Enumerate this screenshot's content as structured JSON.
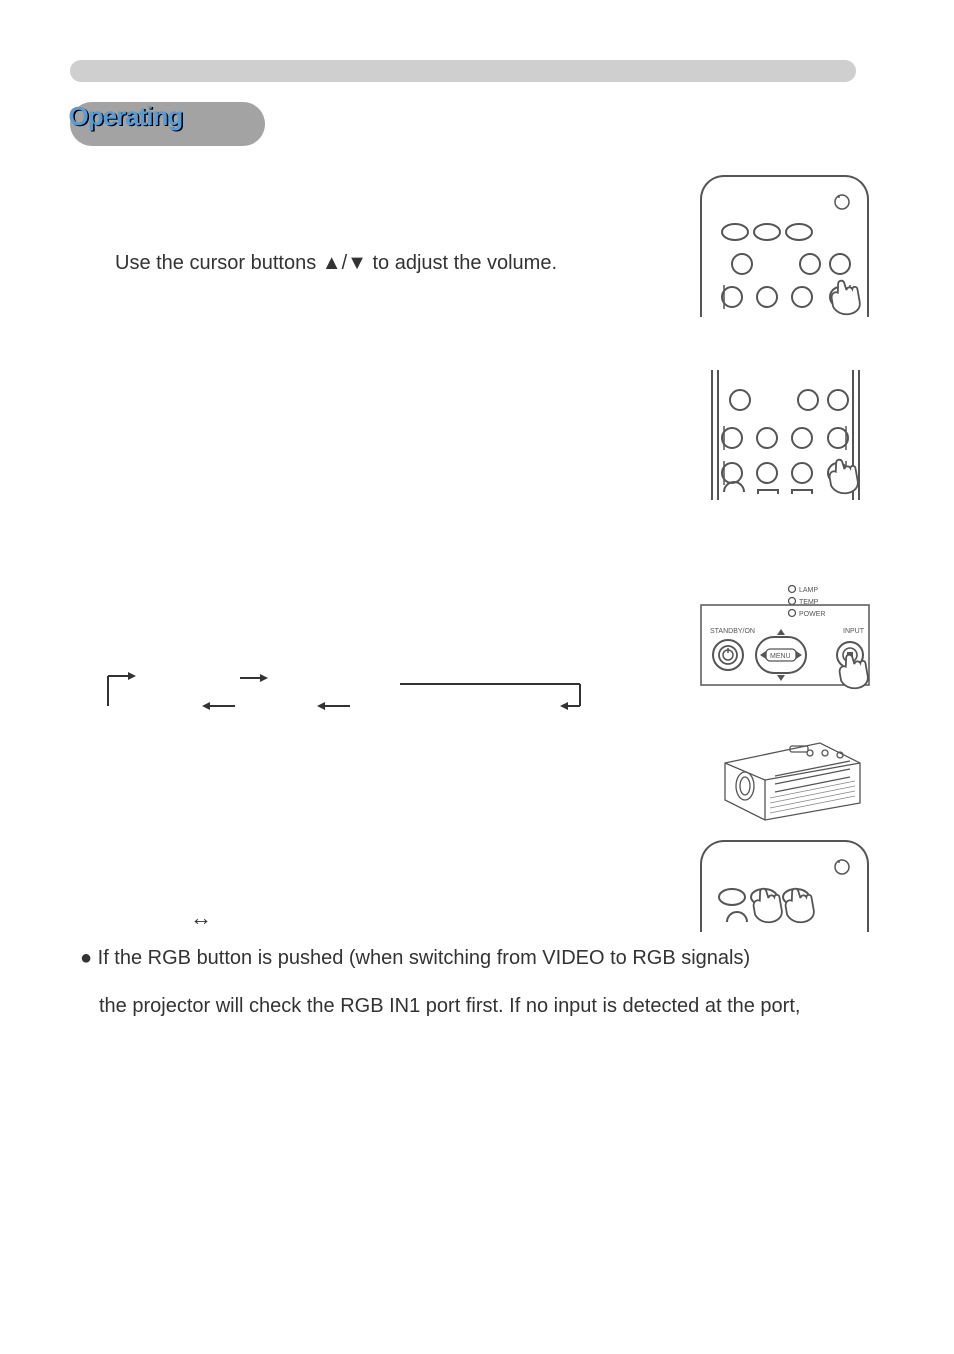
{
  "header": {
    "pill_label": "Operating"
  },
  "body": {
    "volume_instruction": "Use the cursor buttons ▲/▼ to adjust the volume.",
    "rgb_line1": "● If the RGB button is pushed (when switching from VIDEO to RGB signals)",
    "rgb_line2": "the projector will check the RGB IN1 port first. If no input is detected at the port,"
  },
  "panel": {
    "indicator1": "LAMP",
    "indicator2": "TEMP",
    "indicator3": "POWER",
    "label_left": "STANDBY/ON",
    "label_right": "INPUT",
    "label_menu": "MENU"
  },
  "arrows": {
    "right": "→",
    "left": "←",
    "bidir": "↔",
    "corner_down_right": "↳",
    "corner_left_down": "↵"
  },
  "icons": {
    "hand": "☞"
  }
}
